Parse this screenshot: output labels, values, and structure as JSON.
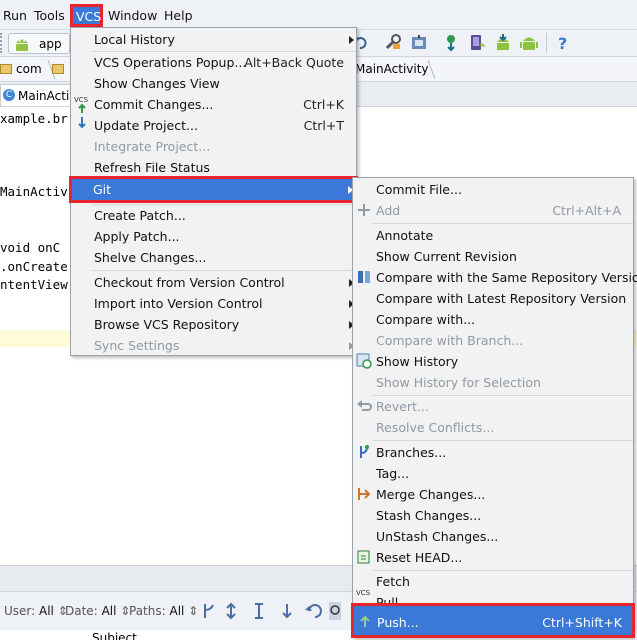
{
  "menubar": {
    "items": [
      "Run",
      "Tools",
      "VCS",
      "Window",
      "Help"
    ]
  },
  "toolbar": {
    "run_config": "app",
    "icons": [
      "undo-icon",
      "project-structure-icon",
      "sdk-manager-icon",
      "sync-gradle-icon",
      "avd-manager-icon",
      "android-device-monitor-icon",
      "android-icon",
      "help-icon"
    ]
  },
  "navbar": {
    "crumbs": [
      "com",
      "",
      "MainActivity"
    ]
  },
  "editor_tab": {
    "label": "MainActivity"
  },
  "editor": {
    "lines": [
      "xample.br",
      "",
      "",
      "MainActiv",
      "",
      "",
      "void onC",
      ".onCreate",
      "ntentView"
    ]
  },
  "vcs_menu": {
    "items": [
      {
        "label": "Local History",
        "submenu": true
      },
      {
        "label": "VCS Operations Popup...",
        "shortcut": "Alt+Back Quote"
      },
      {
        "label": "Show Changes View"
      },
      {
        "label": "Commit Changes...",
        "shortcut": "Ctrl+K",
        "icon": "vcs-commit-icon"
      },
      {
        "label": "Update Project...",
        "shortcut": "Ctrl+T",
        "icon": "vcs-update-icon"
      },
      {
        "label": "Integrate Project...",
        "disabled": true
      },
      {
        "label": "Refresh File Status"
      },
      {
        "label": "Git",
        "submenu": true,
        "selected": true
      },
      {
        "label": "Create Patch..."
      },
      {
        "label": "Apply Patch..."
      },
      {
        "label": "Shelve Changes..."
      },
      {
        "label": "Checkout from Version Control",
        "submenu": true
      },
      {
        "label": "Import into Version Control",
        "submenu": true
      },
      {
        "label": "Browse VCS Repository",
        "submenu": true
      },
      {
        "label": "Sync Settings",
        "disabled": true,
        "submenu": true
      }
    ]
  },
  "git_menu": {
    "items": [
      {
        "label": "Commit File..."
      },
      {
        "label": "Add",
        "shortcut": "Ctrl+Alt+A",
        "disabled": true,
        "icon": "plus-icon"
      },
      {
        "label": "Annotate"
      },
      {
        "label": "Show Current Revision"
      },
      {
        "label": "Compare with the Same Repository Version",
        "icon": "compare-icon"
      },
      {
        "label": "Compare with Latest Repository Version"
      },
      {
        "label": "Compare with..."
      },
      {
        "label": "Compare with Branch...",
        "disabled": true
      },
      {
        "label": "Show History",
        "icon": "history-icon"
      },
      {
        "label": "Show History for Selection",
        "disabled": true
      },
      {
        "label": "Revert...",
        "disabled": true,
        "icon": "revert-icon"
      },
      {
        "label": "Resolve Conflicts...",
        "disabled": true
      },
      {
        "label": "Branches...",
        "icon": "branch-icon"
      },
      {
        "label": "Tag..."
      },
      {
        "label": "Merge Changes...",
        "icon": "merge-icon"
      },
      {
        "label": "Stash Changes..."
      },
      {
        "label": "UnStash Changes..."
      },
      {
        "label": "Reset HEAD...",
        "icon": "reset-icon"
      },
      {
        "label": "Fetch"
      },
      {
        "label": "Pull",
        "icon": "vcs-pull-icon"
      },
      {
        "label": "Push...",
        "shortcut": "Ctrl+Shift+K",
        "selected": true,
        "icon": "vcs-push-icon"
      }
    ]
  },
  "log_filters": {
    "user_label": "User:",
    "user_value": "All",
    "date_label": "Date:",
    "date_value": "All",
    "paths_label": "Paths:",
    "paths_value": "All",
    "subject_header": "Subject"
  },
  "colors": {
    "selection": "#3a79d8",
    "highlight_box": "#e8242c",
    "menu_bg": "#f2f2f2",
    "disabled_text": "#8f9aa5"
  }
}
